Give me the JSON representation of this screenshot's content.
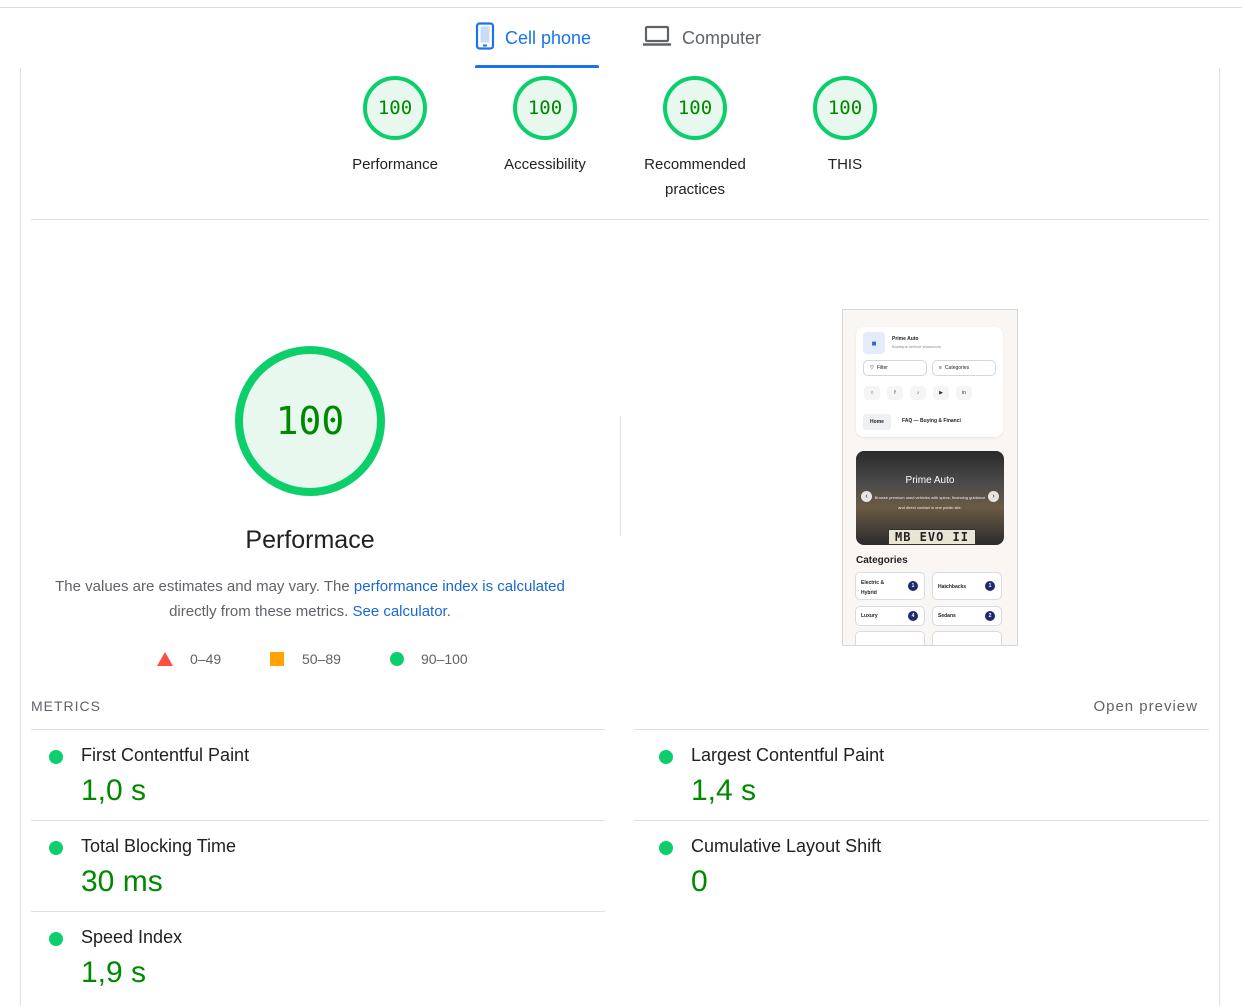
{
  "tabs": [
    {
      "label": "Cell phone",
      "icon": "phone-icon",
      "active": true
    },
    {
      "label": "Computer",
      "icon": "laptop-icon",
      "active": false
    }
  ],
  "gauges": [
    {
      "score": "100",
      "label": "Performance"
    },
    {
      "score": "100",
      "label": "Accessibility"
    },
    {
      "score": "100",
      "label": "Recommended practices"
    },
    {
      "score": "100",
      "label": "THIS"
    }
  ],
  "performance": {
    "score": "100",
    "title": "Performace",
    "desc_prefix": "The values are estimates and may vary. The",
    "desc_link": "performance index is calculated",
    "desc_middle": "directly from these metrics.",
    "calc_link": "See calculator.",
    "legend": [
      {
        "range": "0–49",
        "shape": "triangle",
        "color": "#ff4e42"
      },
      {
        "range": "50–89",
        "shape": "square",
        "color": "#ffa400"
      },
      {
        "range": "90–100",
        "shape": "circle",
        "color": "#0cce6b"
      }
    ]
  },
  "preview": {
    "brand": "Prime Auto",
    "tagline": "Boutique vehicle showroom",
    "filter_btn": "Filter",
    "categories_btn": "Categories",
    "nav_home": "Home",
    "nav_faq": "FAQ — Buying & Financi",
    "hero_title": "Prime Auto",
    "hero_text": "Browse premium used vehicles with specs, financing guidance and direct contact in one public site.",
    "plate": "MB EVO II",
    "categories_title": "Categories",
    "categories": [
      {
        "name": "Electric & Hybrid",
        "count": "1"
      },
      {
        "name": "Hatchbacks",
        "count": "1"
      },
      {
        "name": "Luxury",
        "count": "4"
      },
      {
        "name": "Sedans",
        "count": "2"
      }
    ]
  },
  "metrics": {
    "title": "METRICS",
    "open_preview": "Open preview",
    "items": [
      {
        "label": "First Contentful Paint",
        "value": "1,0 s"
      },
      {
        "label": "Largest Contentful Paint",
        "value": "1,4 s"
      },
      {
        "label": "Total Blocking Time",
        "value": "30 ms"
      },
      {
        "label": "Cumulative Layout Shift",
        "value": "0"
      },
      {
        "label": "Speed Index",
        "value": "1,9 s"
      }
    ]
  },
  "colors": {
    "pass": "#0cce6b",
    "pass_text": "#008800",
    "accent": "#1a73e8"
  }
}
